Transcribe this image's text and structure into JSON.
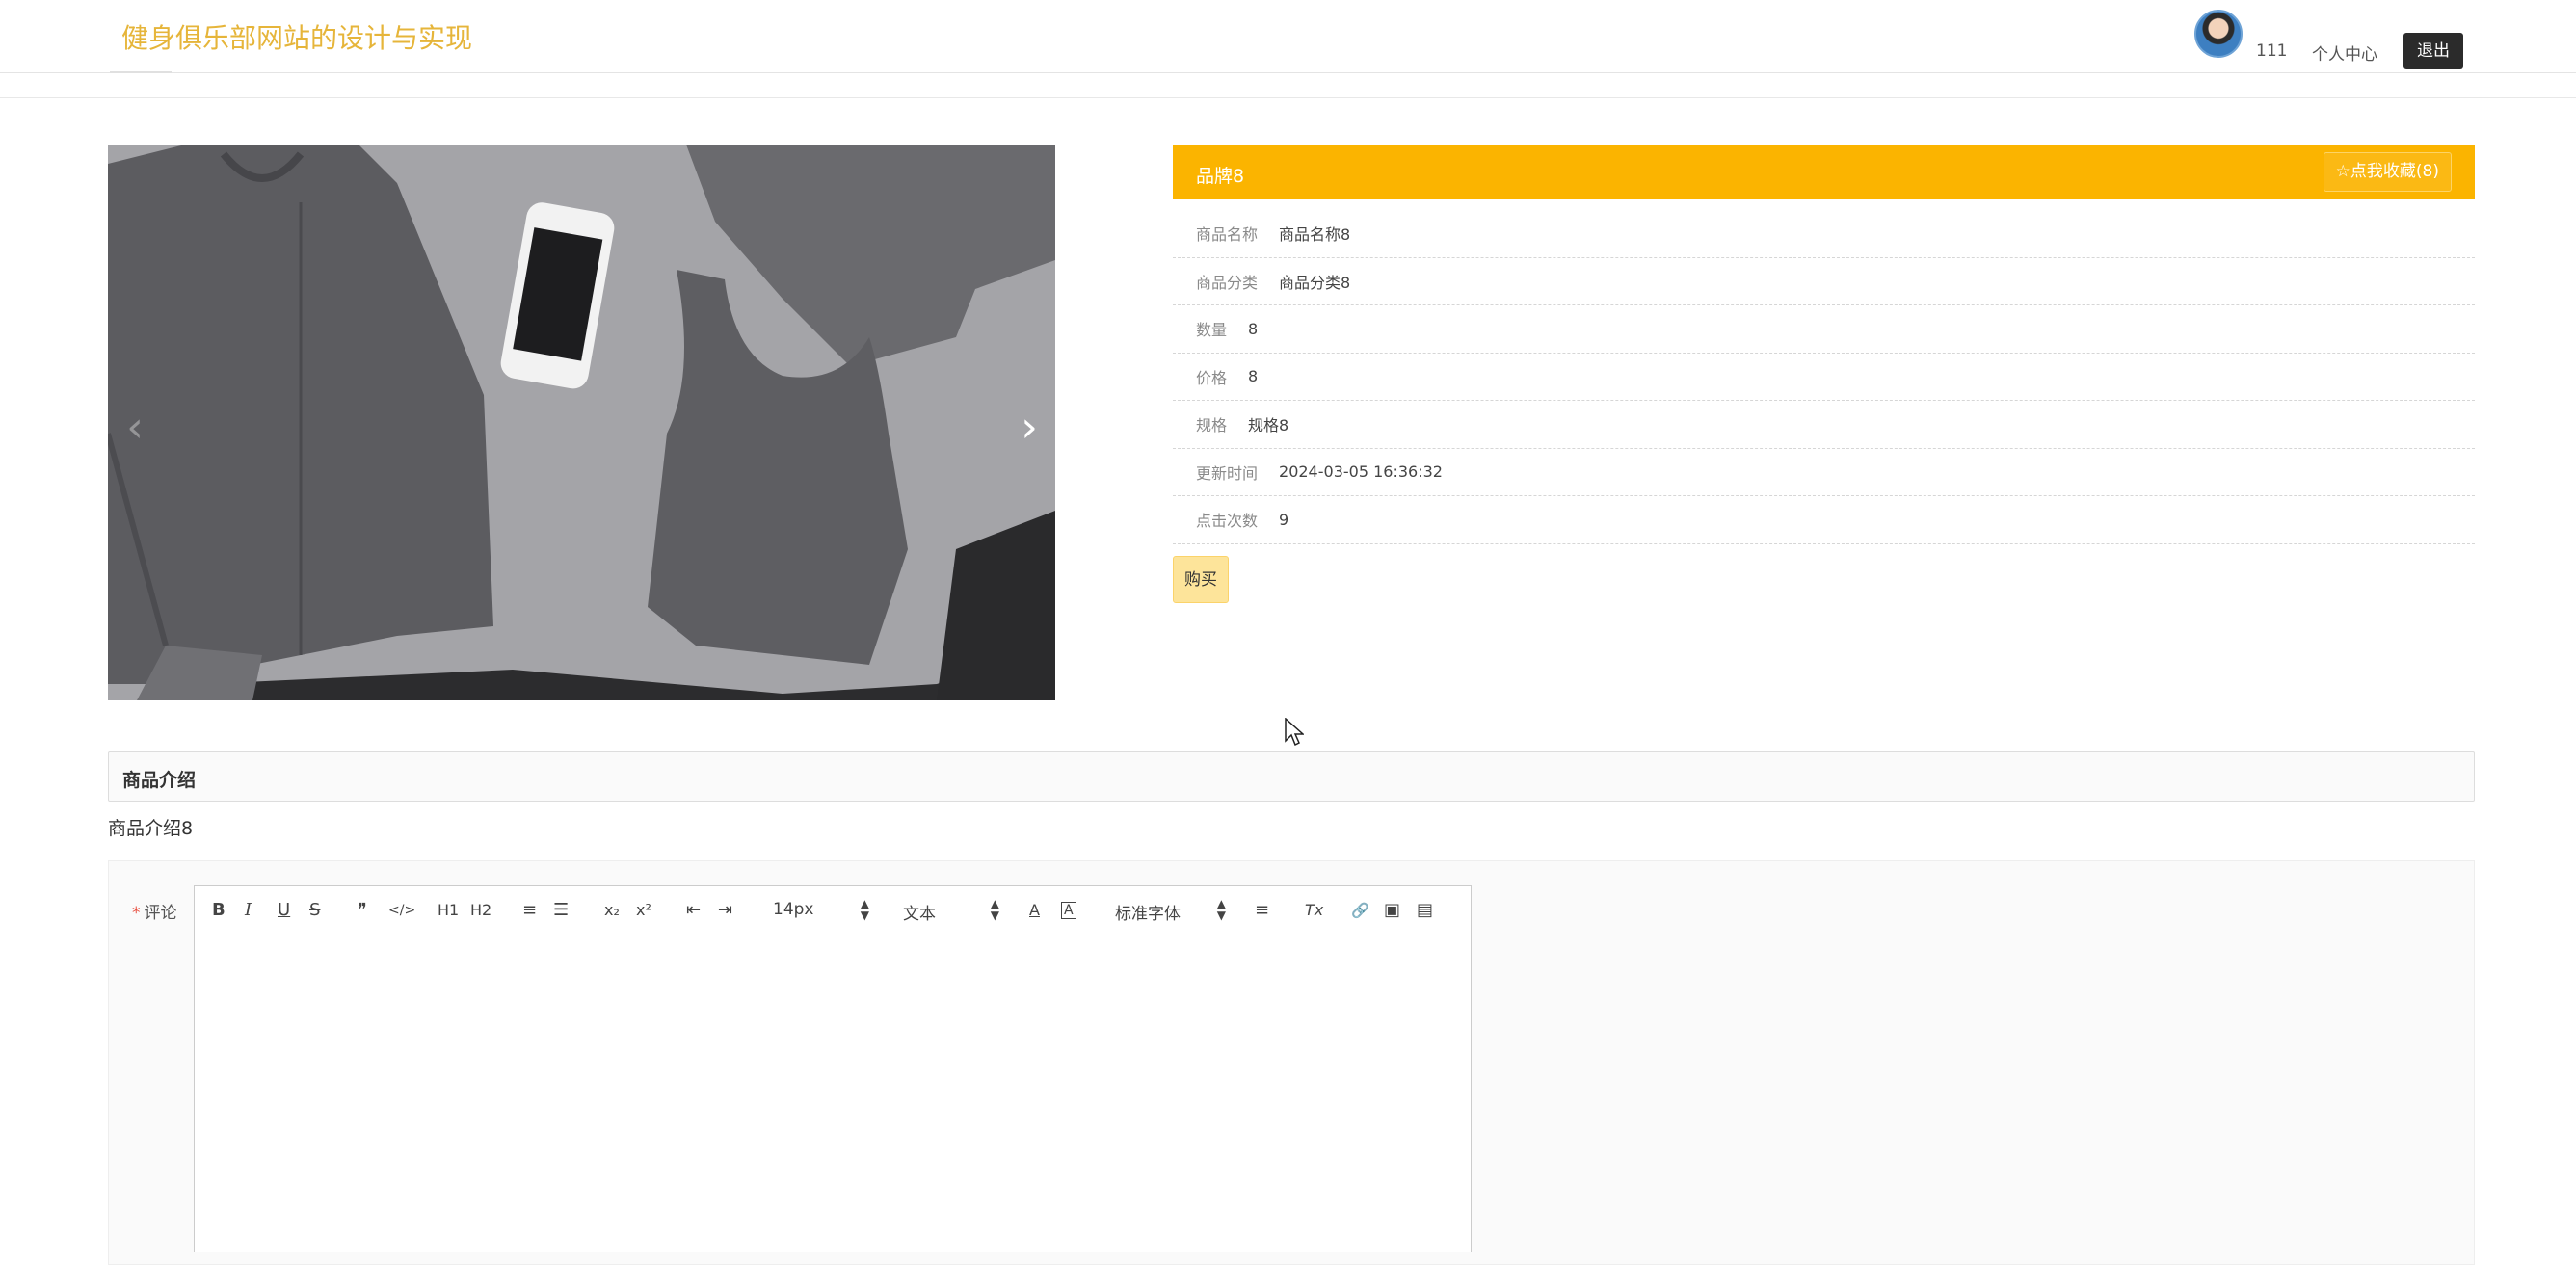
{
  "header": {
    "site_title": "健身俱乐部网站的设计与实现",
    "username": "111",
    "user_center": "个人中心",
    "logout": "退出"
  },
  "product": {
    "brand": "品牌8",
    "favorite": "☆点我收藏(8)",
    "fields": [
      {
        "label": "商品名称",
        "value": "商品名称8"
      },
      {
        "label": "商品分类",
        "value": "商品分类8"
      },
      {
        "label": "数量",
        "value": "8"
      },
      {
        "label": "价格",
        "value": "8"
      },
      {
        "label": "规格",
        "value": "规格8"
      },
      {
        "label": "更新时间",
        "value": "2024-03-05 16:36:32"
      },
      {
        "label": "点击次数",
        "value": "9"
      }
    ],
    "buy": "购买"
  },
  "carousel": {
    "prev_icon": "chevron-left-icon",
    "next_icon": "chevron-right-icon",
    "prev_glyph": "‹",
    "next_glyph": "›"
  },
  "intro": {
    "title": "商品介绍",
    "text": "商品介绍8"
  },
  "comment": {
    "required_mark": "*",
    "label": "评论",
    "toolbar": {
      "bold": "B",
      "italic": "I",
      "underline": "U",
      "strike": "S",
      "quote": "❞",
      "code": "</>",
      "h1": "H1",
      "h2": "H2",
      "ol": "≡",
      "ul": "☰",
      "sub": "x₂",
      "sup": "x²",
      "outdent": "⇤",
      "indent": "⇥",
      "size": "14px",
      "header": "文本",
      "font": "标准字体",
      "align": "≡",
      "clean": "Tx",
      "link": "🔗",
      "image": "▣",
      "video": "▤",
      "color": "A",
      "background": "A"
    }
  },
  "colors": {
    "accent": "#fbb400",
    "title": "#e6b53a",
    "logout_bg": "#2b2b2b",
    "buy_bg": "#fde49a"
  }
}
